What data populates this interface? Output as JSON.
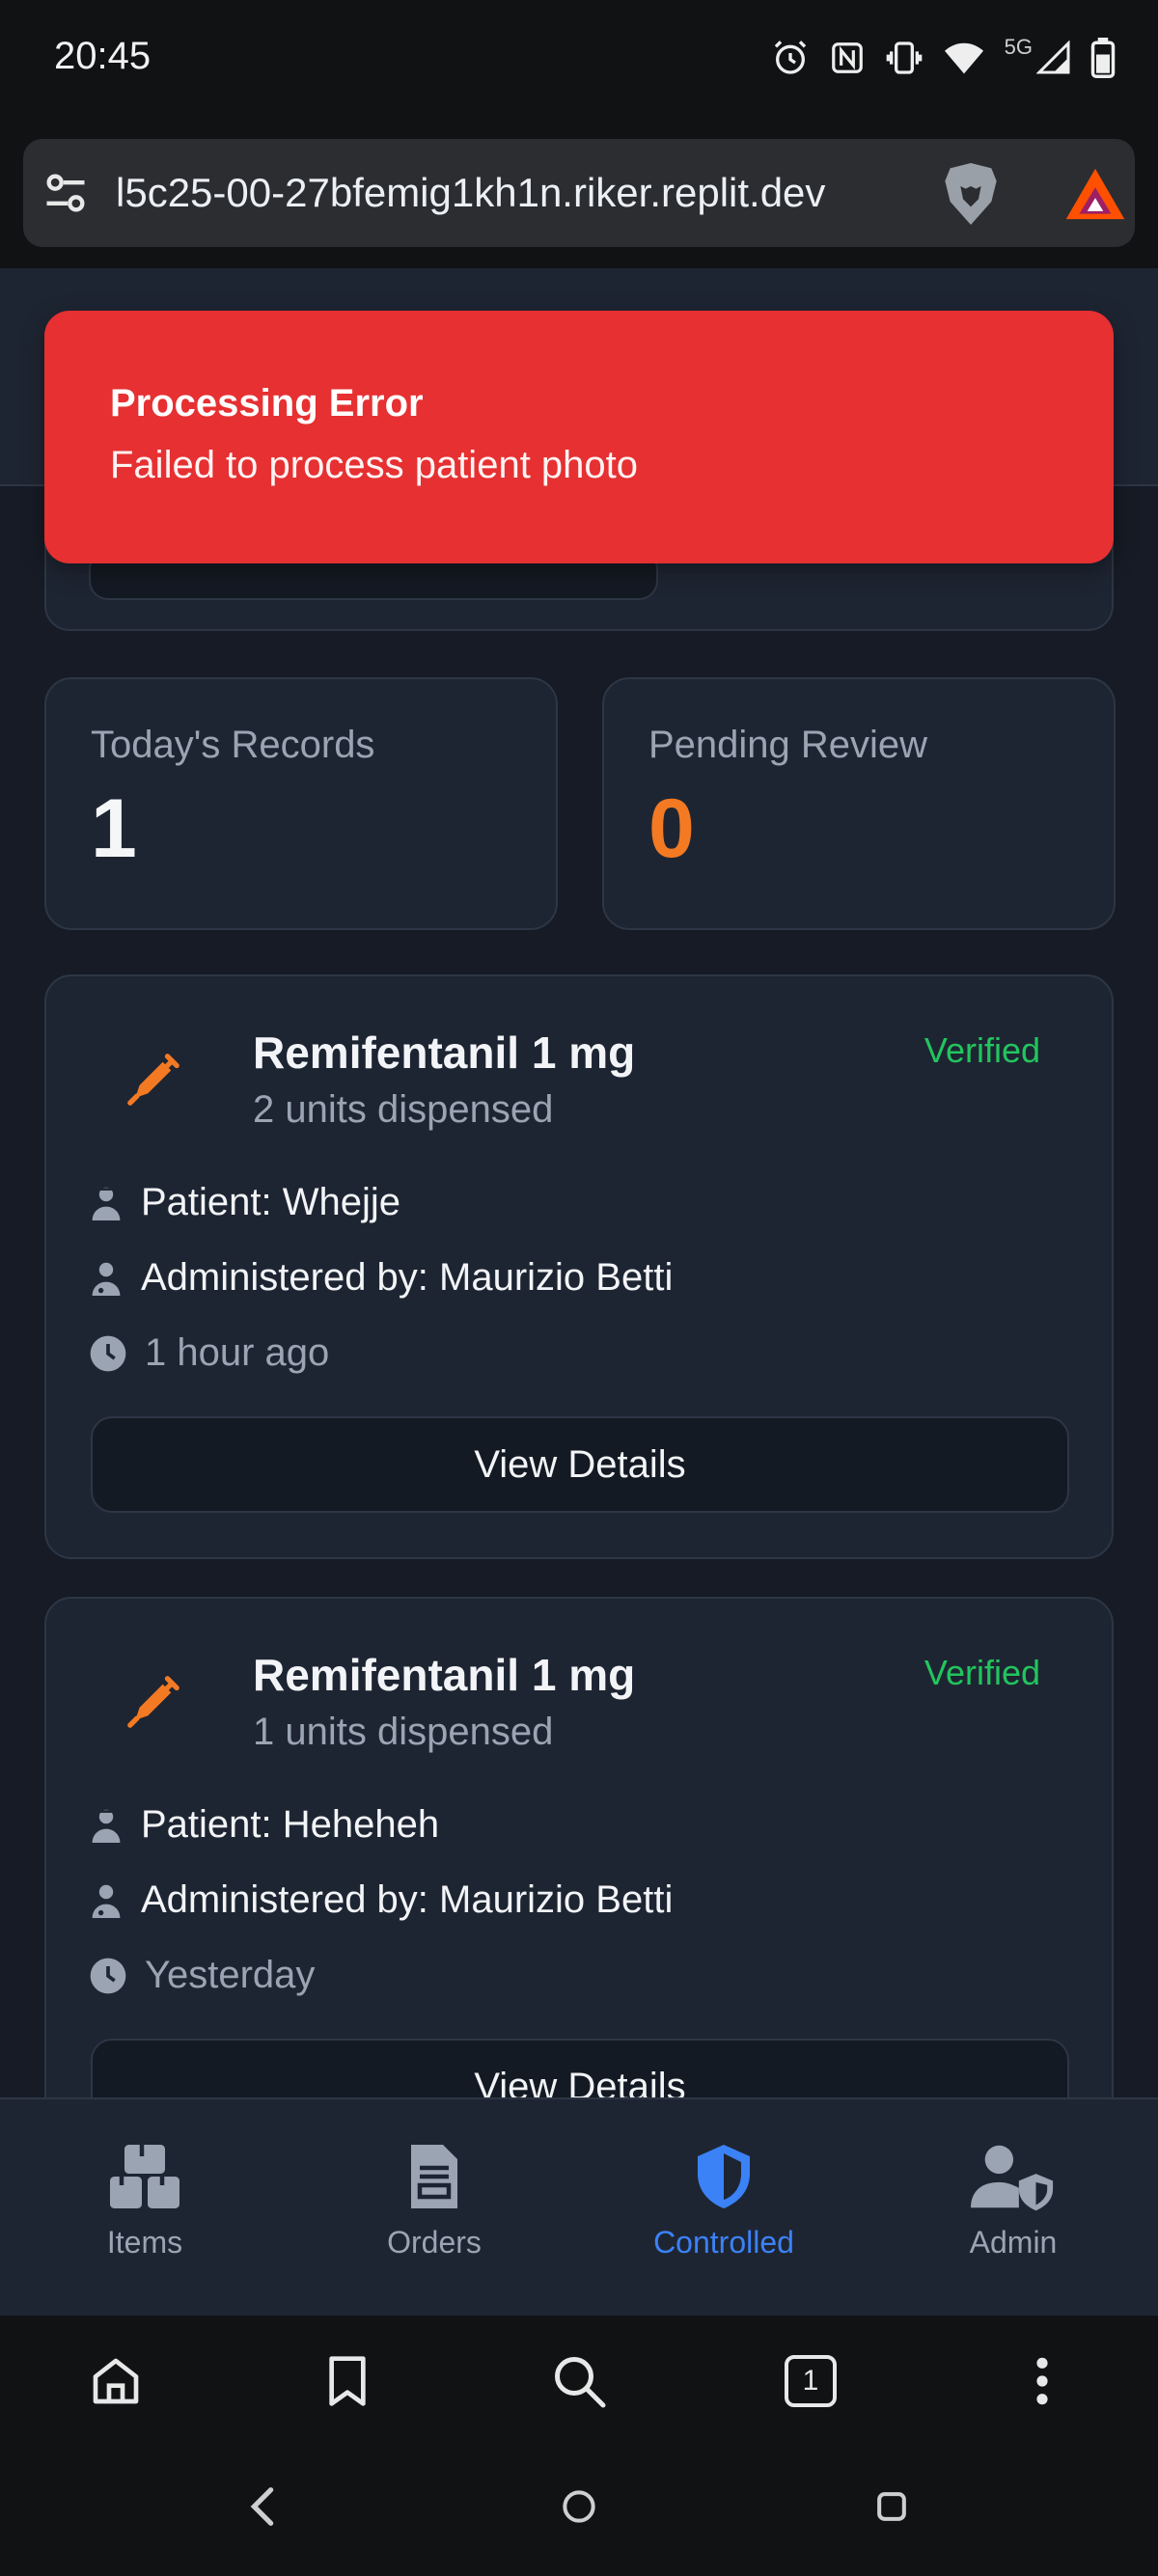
{
  "status_bar": {
    "time": "20:45",
    "network": "5G"
  },
  "browser": {
    "url": "l5c25-00-27bfemig1kh1n.riker.replit.dev",
    "tab_count": "1"
  },
  "toast": {
    "title": "Processing Error",
    "message": "Failed to process patient photo"
  },
  "stats": [
    {
      "label": "Today's Records",
      "value": "1"
    },
    {
      "label": "Pending Review",
      "value": "0"
    }
  ],
  "records": [
    {
      "title": "Remifentanil 1 mg",
      "subtitle": "2 units dispensed",
      "status": "Verified",
      "patient": "Patient: Whejje",
      "administered_by": "Administered by: Maurizio Betti",
      "time": "1 hour ago",
      "button": "View Details"
    },
    {
      "title": "Remifentanil 1 mg",
      "subtitle": "1 units dispensed",
      "status": "Verified",
      "patient": "Patient: Heheheh",
      "administered_by": "Administered by: Maurizio Betti",
      "time": "Yesterday",
      "button": "View Details"
    }
  ],
  "app_nav": [
    {
      "label": "Items",
      "icon": "boxes-icon",
      "active": false
    },
    {
      "label": "Orders",
      "icon": "clipboard-icon",
      "active": false
    },
    {
      "label": "Controlled",
      "icon": "shield-icon",
      "active": true
    },
    {
      "label": "Admin",
      "icon": "user-shield-icon",
      "active": false
    }
  ],
  "colors": {
    "toast_bg": "#e63032",
    "verified": "#22c55e",
    "pending_value": "#f37a23",
    "active_nav": "#3b82f6",
    "syringe": "#f37a23"
  }
}
